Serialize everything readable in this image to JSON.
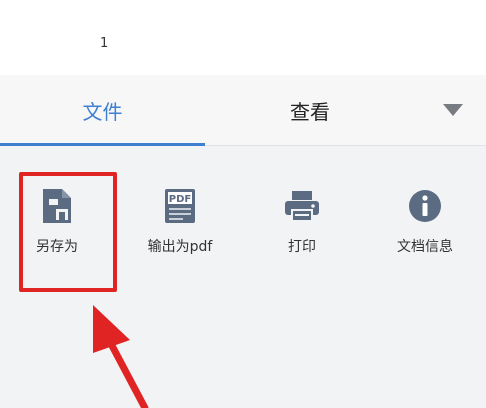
{
  "document": {
    "page_number": "1"
  },
  "tabs": [
    {
      "label": "文件",
      "active": true
    },
    {
      "label": "查看",
      "active": false
    }
  ],
  "actions": [
    {
      "label": "另存为",
      "icon": "save-file-icon"
    },
    {
      "label": "输出为pdf",
      "icon": "pdf-icon"
    },
    {
      "label": "打印",
      "icon": "printer-icon"
    },
    {
      "label": "文档信息",
      "icon": "info-icon"
    }
  ],
  "colors": {
    "accent": "#3f7fd0",
    "icon": "#5b6b82",
    "annotation": "#e02424",
    "panel_background": "#f2f3f5"
  }
}
